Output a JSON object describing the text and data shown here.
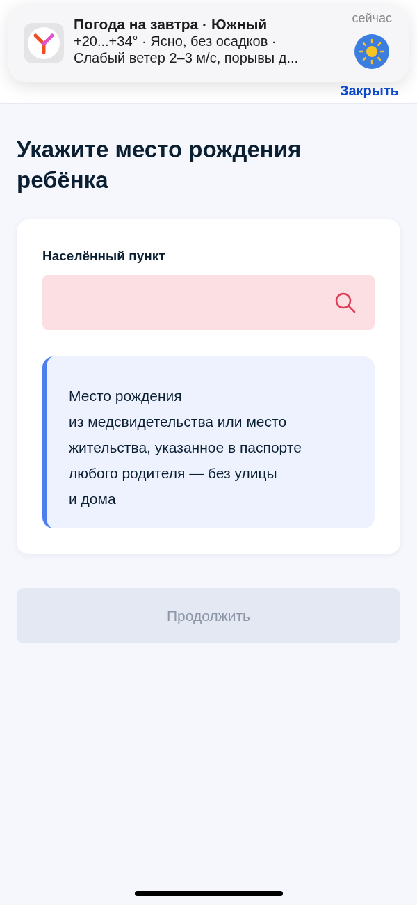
{
  "notification": {
    "title": "Погода на завтра · Южный",
    "time": "сейчас",
    "lines": [
      "+20...+34° · Ясно, без осадков ·",
      "Слабый ветер 2–3 м/с, порывы д..."
    ]
  },
  "header": {
    "close_link": "Закрыть"
  },
  "heading": "Укажите место рождения ребёнка",
  "form": {
    "field": {
      "label": "Населённый пункт",
      "invalid": true
    },
    "info": "Место рождения\nиз медсвидетельства или место\nжительства, указанное в паспорте\nлюбого родителя — без улицы\nи дома"
  },
  "continue_button": {
    "label": "Продолжить",
    "disabled": true
  }
}
